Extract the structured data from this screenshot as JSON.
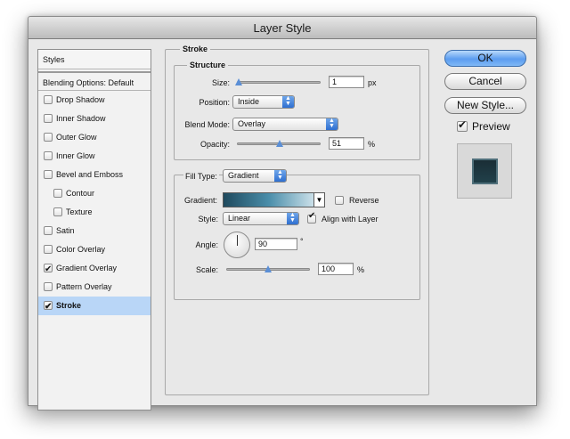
{
  "window": {
    "title": "Layer Style"
  },
  "styles_panel": {
    "header": "Styles",
    "blending_options": "Blending Options: Default",
    "items": [
      {
        "label": "Drop Shadow",
        "checked": false,
        "sub": false,
        "selected": false
      },
      {
        "label": "Inner Shadow",
        "checked": false,
        "sub": false,
        "selected": false
      },
      {
        "label": "Outer Glow",
        "checked": false,
        "sub": false,
        "selected": false
      },
      {
        "label": "Inner Glow",
        "checked": false,
        "sub": false,
        "selected": false
      },
      {
        "label": "Bevel and Emboss",
        "checked": false,
        "sub": false,
        "selected": false
      },
      {
        "label": "Contour",
        "checked": false,
        "sub": true,
        "selected": false
      },
      {
        "label": "Texture",
        "checked": false,
        "sub": true,
        "selected": false
      },
      {
        "label": "Satin",
        "checked": false,
        "sub": false,
        "selected": false
      },
      {
        "label": "Color Overlay",
        "checked": false,
        "sub": false,
        "selected": false
      },
      {
        "label": "Gradient Overlay",
        "checked": true,
        "sub": false,
        "selected": false
      },
      {
        "label": "Pattern Overlay",
        "checked": false,
        "sub": false,
        "selected": false
      },
      {
        "label": "Stroke",
        "checked": true,
        "sub": false,
        "selected": true
      }
    ]
  },
  "stroke": {
    "title": "Stroke",
    "structure": {
      "title": "Structure",
      "size_label": "Size:",
      "size_value": "1",
      "size_unit": "px",
      "size_slider": 0.02,
      "position_label": "Position:",
      "position_value": "Inside",
      "blend_label": "Blend Mode:",
      "blend_value": "Overlay",
      "opacity_label": "Opacity:",
      "opacity_value": "51",
      "opacity_unit": "%",
      "opacity_slider": 0.51
    },
    "fill": {
      "fill_type_label": "Fill Type:",
      "fill_type_value": "Gradient",
      "gradient_label": "Gradient:",
      "reverse_label": "Reverse",
      "reverse_checked": false,
      "style_label": "Style:",
      "style_value": "Linear",
      "align_label": "Align with Layer",
      "align_checked": true,
      "angle_label": "Angle:",
      "angle_value": "90",
      "angle_unit": "°",
      "scale_label": "Scale:",
      "scale_value": "100",
      "scale_unit": "%",
      "scale_slider": 0.5
    }
  },
  "buttons": {
    "ok": "OK",
    "cancel": "Cancel",
    "new_style": "New Style...",
    "preview_label": "Preview",
    "preview_checked": true
  },
  "colors": {
    "selected_row": "#b9d6f7",
    "default_button": "#5c9df0",
    "gradient_dark": "#1f4a5e",
    "gradient_light": "#e9f3f8"
  }
}
